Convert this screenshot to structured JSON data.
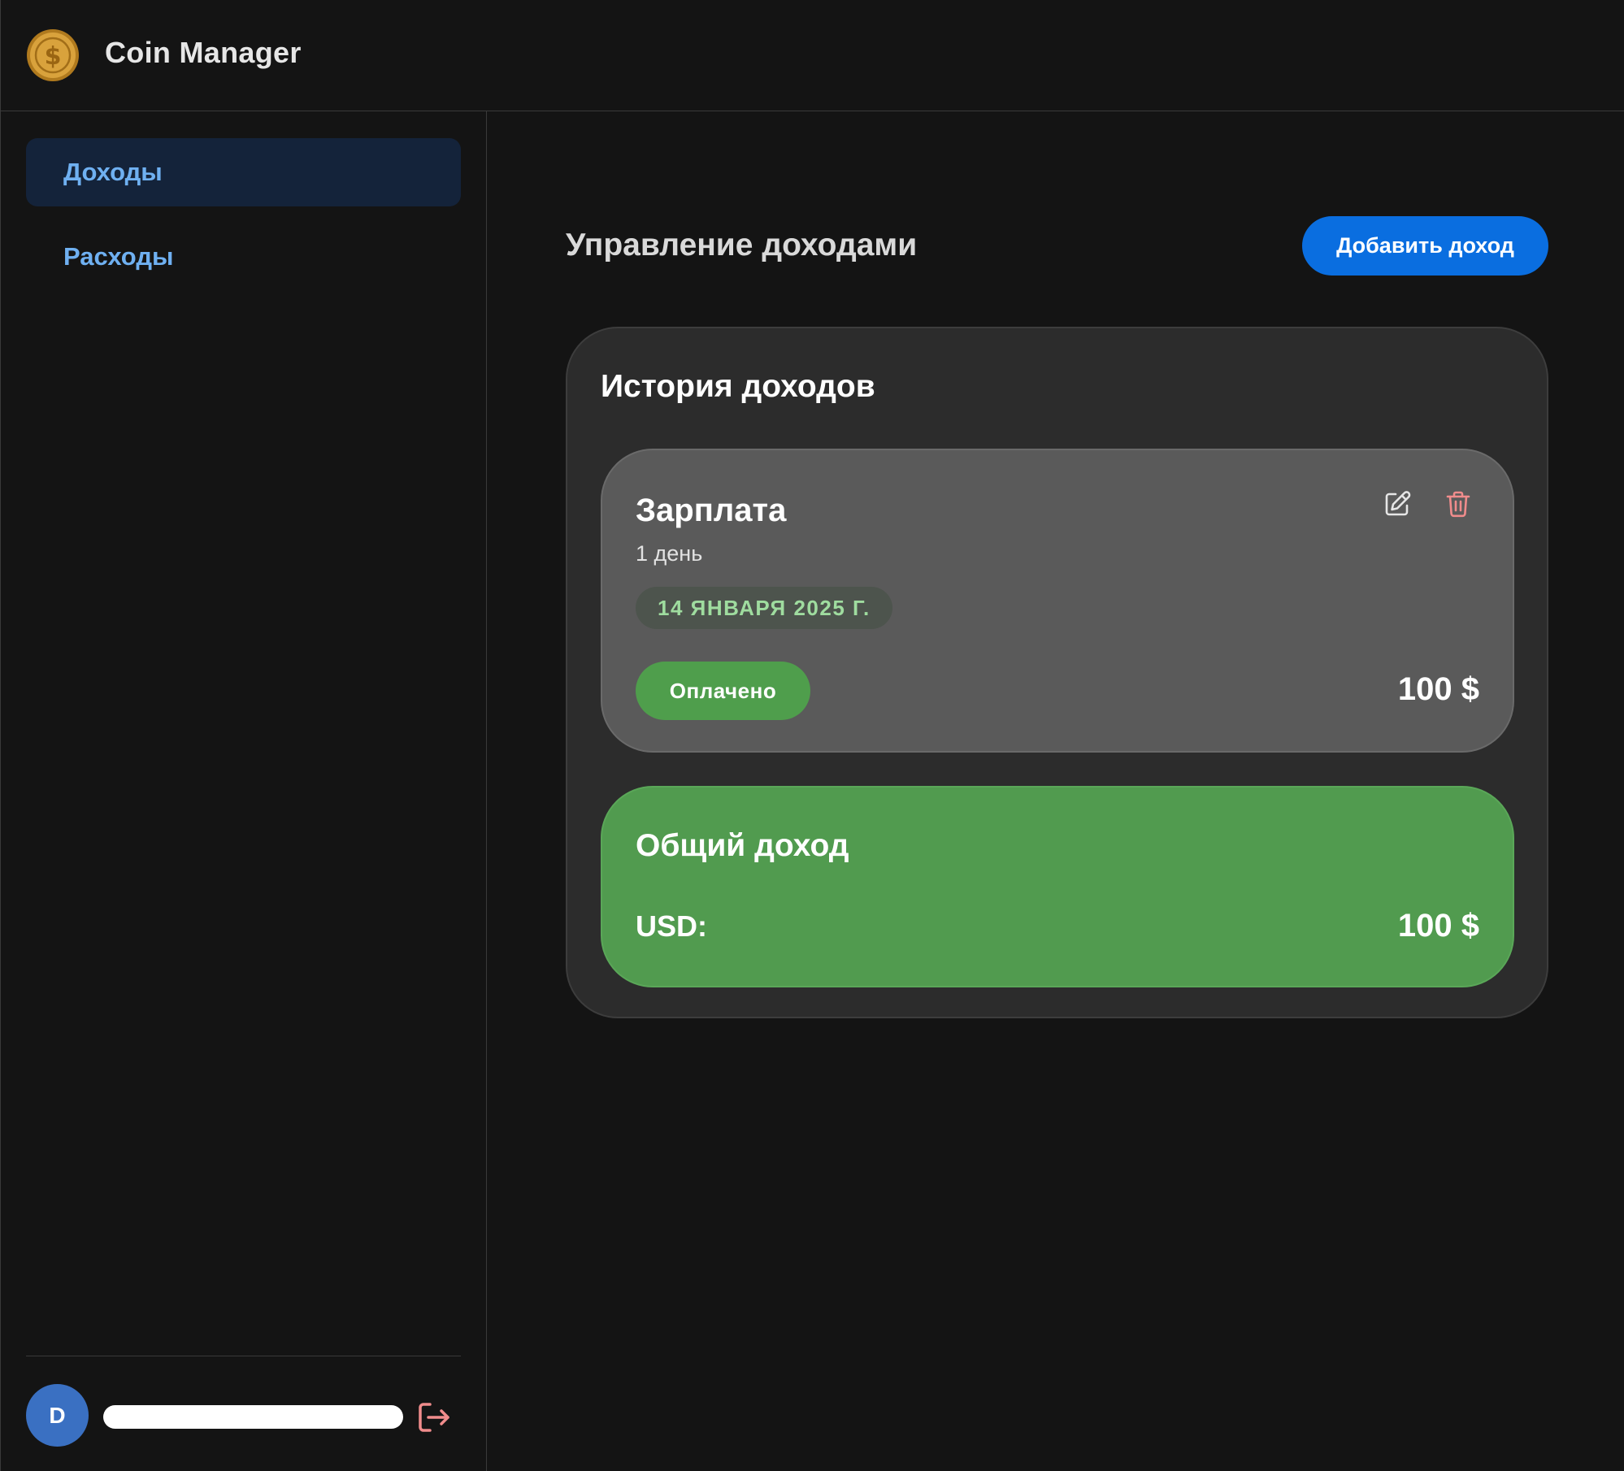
{
  "header": {
    "app_title": "Coin Manager",
    "logo_icon": "coin-dollar-icon",
    "logo_glyph": "$"
  },
  "sidebar": {
    "items": [
      {
        "label": "Доходы",
        "active": true
      },
      {
        "label": "Расходы",
        "active": false
      }
    ],
    "user": {
      "avatar_letter": "D",
      "email": "",
      "logout_icon": "logout-icon"
    }
  },
  "main": {
    "page_title": "Управление доходами",
    "add_button_label": "Добавить доход",
    "history": {
      "title": "История доходов",
      "items": [
        {
          "name": "Зарплата",
          "period": "1 день",
          "date": "14 ЯНВАРЯ 2025 Г.",
          "status": "Оплачено",
          "amount": "100 $",
          "edit_icon": "pencil-edit-icon",
          "delete_icon": "trash-icon"
        }
      ]
    },
    "total": {
      "title": "Общий доход",
      "currency_label": "USD:",
      "amount": "100 $"
    }
  },
  "colors": {
    "background": "#141414",
    "accent": "#0a6ee0",
    "nav_text": "#6fb0f1",
    "nav_active_bg": "#14233a",
    "card": "#2c2c2c",
    "item_card": "#5a5a5a",
    "success": "#519b4f",
    "date_text": "#9fdc9f",
    "danger_icon": "#f08c8c",
    "avatar": "#3a70c2"
  }
}
